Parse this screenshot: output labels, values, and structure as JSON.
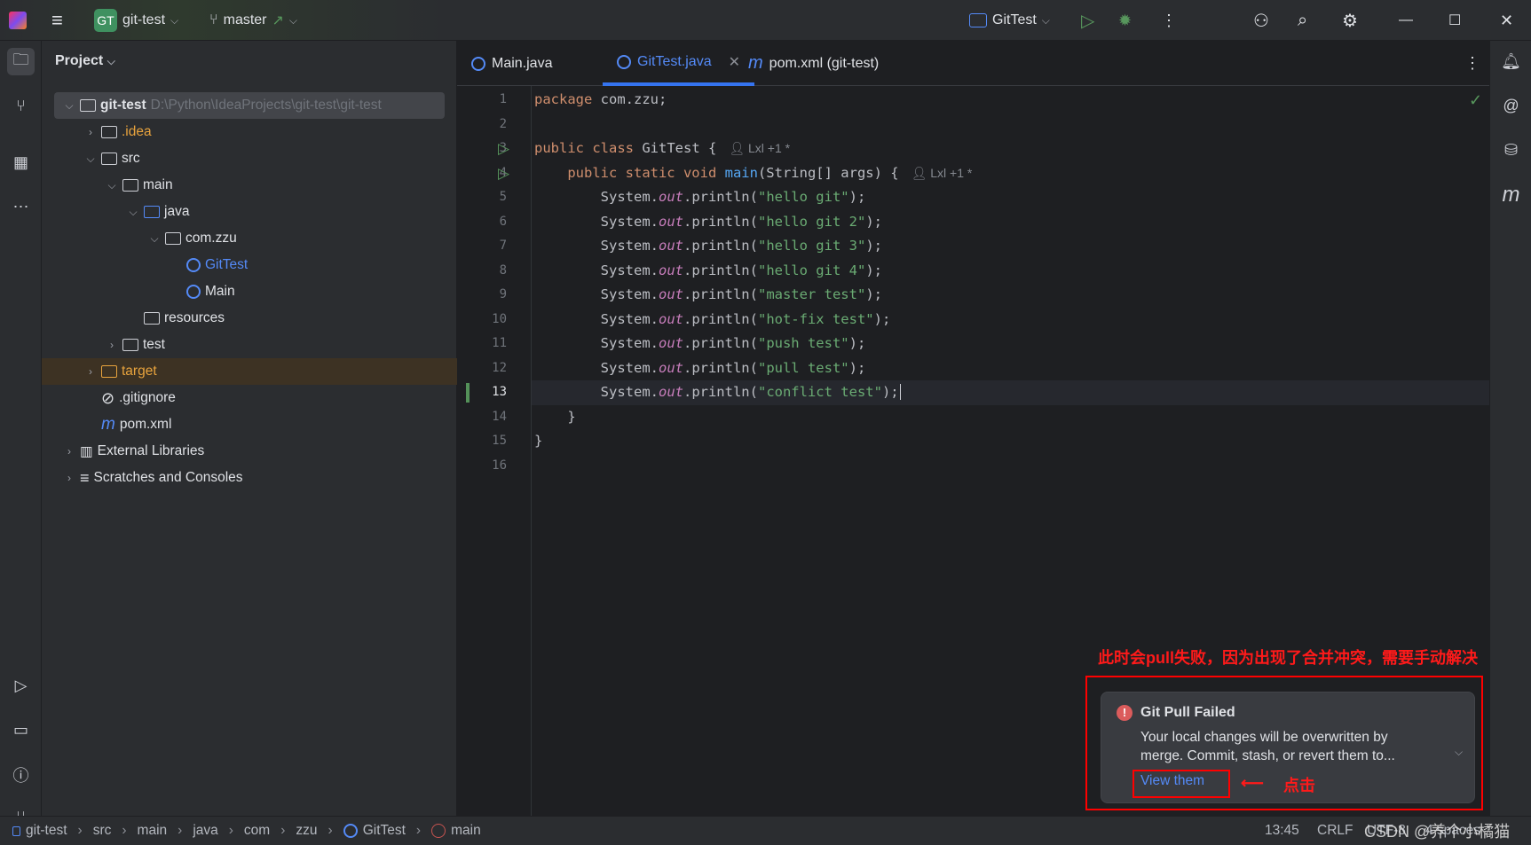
{
  "titlebar": {
    "project_badge": "GT",
    "project": "git-test",
    "branch": "master",
    "run_config": "GitTest"
  },
  "project_panel": {
    "title": "Project",
    "tree": [
      {
        "label": "git-test",
        "path": "D:\\Python\\IdeaProjects\\git-test\\git-test",
        "depth": 0,
        "expanded": true,
        "icon": "module-folder-icon"
      },
      {
        "label": ".idea",
        "depth": 1,
        "expanded": false,
        "icon": "folder-icon",
        "color": "#e8a33d"
      },
      {
        "label": "src",
        "depth": 1,
        "expanded": true,
        "icon": "folder-icon"
      },
      {
        "label": "main",
        "depth": 2,
        "expanded": true,
        "icon": "folder-icon"
      },
      {
        "label": "java",
        "depth": 3,
        "expanded": true,
        "icon": "source-folder-icon"
      },
      {
        "label": "com.zzu",
        "depth": 4,
        "expanded": true,
        "icon": "package-icon"
      },
      {
        "label": "GitTest",
        "depth": 5,
        "icon": "java-class-icon",
        "color": "#548af7"
      },
      {
        "label": "Main",
        "depth": 5,
        "icon": "java-class-icon"
      },
      {
        "label": "resources",
        "depth": 3,
        "icon": "resources-folder-icon"
      },
      {
        "label": "test",
        "depth": 2,
        "expanded": false,
        "icon": "folder-icon"
      },
      {
        "label": "target",
        "depth": 1,
        "expanded": false,
        "icon": "excluded-folder-icon",
        "color": "#e8a33d"
      },
      {
        "label": ".gitignore",
        "depth": 1,
        "icon": "ignore-file-icon"
      },
      {
        "label": "pom.xml",
        "depth": 1,
        "icon": "maven-icon"
      },
      {
        "label": "External Libraries",
        "depth": 0,
        "expanded": false,
        "icon": "library-icon"
      },
      {
        "label": "Scratches and Consoles",
        "depth": 0,
        "expanded": false,
        "icon": "scratches-icon"
      }
    ]
  },
  "tabs": [
    {
      "label": "Main.java"
    },
    {
      "label": "GitTest.java",
      "active": true
    },
    {
      "label": "pom.xml (git-test)"
    }
  ],
  "editor": {
    "current_line": 13,
    "author_hint": "Lxl +1 *",
    "lines": [
      [
        [
          "kw",
          "package "
        ],
        [
          "",
          "com.zzu;"
        ]
      ],
      [],
      [
        [
          "kw",
          "public class "
        ],
        [
          "",
          "GitTest {"
        ]
      ],
      [
        [
          "",
          "    "
        ],
        [
          "kw",
          "public static void "
        ],
        [
          "fn",
          "main"
        ],
        [
          "",
          "(String[] args) {"
        ]
      ],
      [
        [
          "",
          "        System."
        ],
        [
          "out",
          "out"
        ],
        [
          "",
          ".println("
        ],
        [
          "str",
          "\"hello git\""
        ],
        [
          "",
          ");"
        ]
      ],
      [
        [
          "",
          "        System."
        ],
        [
          "out",
          "out"
        ],
        [
          "",
          ".println("
        ],
        [
          "str",
          "\"hello git 2\""
        ],
        [
          "",
          ");"
        ]
      ],
      [
        [
          "",
          "        System."
        ],
        [
          "out",
          "out"
        ],
        [
          "",
          ".println("
        ],
        [
          "str",
          "\"hello git 3\""
        ],
        [
          "",
          ");"
        ]
      ],
      [
        [
          "",
          "        System."
        ],
        [
          "out",
          "out"
        ],
        [
          "",
          ".println("
        ],
        [
          "str",
          "\"hello git 4\""
        ],
        [
          "",
          ");"
        ]
      ],
      [
        [
          "",
          "        System."
        ],
        [
          "out",
          "out"
        ],
        [
          "",
          ".println("
        ],
        [
          "str",
          "\"master test\""
        ],
        [
          "",
          ");"
        ]
      ],
      [
        [
          "",
          "        System."
        ],
        [
          "out",
          "out"
        ],
        [
          "",
          ".println("
        ],
        [
          "str",
          "\"hot-fix test\""
        ],
        [
          "",
          ");"
        ]
      ],
      [
        [
          "",
          "        System."
        ],
        [
          "out",
          "out"
        ],
        [
          "",
          ".println("
        ],
        [
          "str",
          "\"push test\""
        ],
        [
          "",
          ");"
        ]
      ],
      [
        [
          "",
          "        System."
        ],
        [
          "out",
          "out"
        ],
        [
          "",
          ".println("
        ],
        [
          "str",
          "\"pull test\""
        ],
        [
          "",
          ");"
        ]
      ],
      [
        [
          "",
          "        System."
        ],
        [
          "out",
          "out"
        ],
        [
          "",
          ".println("
        ],
        [
          "str",
          "\"conflict test\""
        ],
        [
          "",
          ");"
        ]
      ],
      [
        [
          "",
          "    }"
        ]
      ],
      [
        [
          "",
          "}"
        ]
      ],
      []
    ]
  },
  "notification": {
    "title": "Git Pull Failed",
    "body": "Your local changes will be overwritten by merge. Commit, stash, or revert them to...",
    "link": "View them"
  },
  "annotations": {
    "top": "此时会pull失败，因为出现了合并冲突，需要手动解决",
    "click": "点击",
    "color": "#ff0000"
  },
  "statusbar": {
    "crumbs": [
      "git-test",
      "src",
      "main",
      "java",
      "com",
      "zzu",
      "GitTest",
      "main"
    ],
    "position": "13:45",
    "line_sep": "CRLF",
    "encoding": "UTF-8",
    "indent": "4 spaces"
  },
  "watermark": "CSDN @养个小橘猫"
}
